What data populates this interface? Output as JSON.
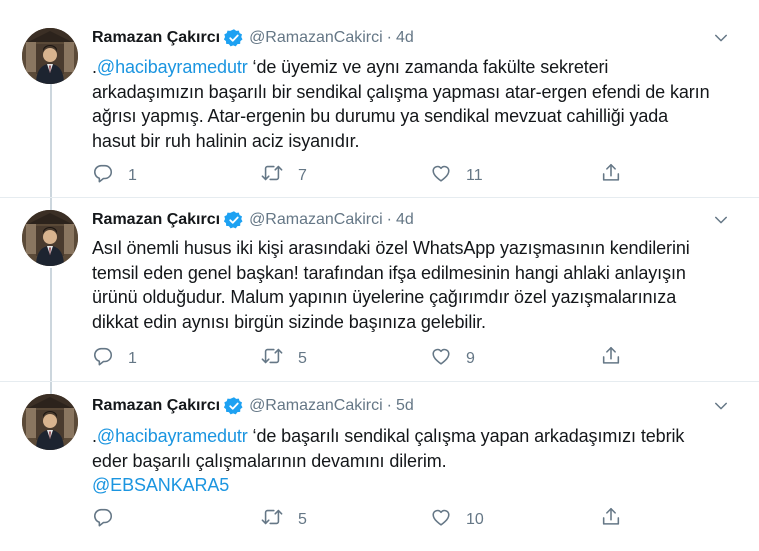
{
  "tweets": [
    {
      "author_name": "Ramazan Çakırcı",
      "handle": "@RamazanCakirci",
      "separator": "·",
      "time": "4d",
      "lines": [
        [
          {
            "t": "."
          },
          {
            "t": "@hacibayramedutr",
            "link": true
          },
          {
            "t": " ‘de  üyemiz ve aynı zamanda fakülte sekreteri"
          }
        ],
        [
          {
            "t": "arkadaşımızın başarılı bir sendikal çalışma yapması atar-ergen efendi de karın"
          }
        ],
        [
          {
            "t": "ağrısı yapmış. Atar-ergenin bu durumu ya sendikal mevzuat  cahilliği yada"
          }
        ],
        [
          {
            "t": "hasut bir ruh halinin aciz isyanıdır."
          }
        ]
      ],
      "reply_count": "1",
      "retweet_count": "7",
      "like_count": "11"
    },
    {
      "author_name": "Ramazan Çakırcı",
      "handle": "@RamazanCakirci",
      "separator": "·",
      "time": "4d",
      "lines": [
        [
          {
            "t": "Asıl önemli husus iki kişi arasındaki özel WhatsApp yazışmasının kendilerini"
          }
        ],
        [
          {
            "t": "temsil eden genel başkan! tarafından ifşa edilmesinin hangi ahlaki anlayışın"
          }
        ],
        [
          {
            "t": "ürünü olduğudur. Malum yapının üyelerine çağırımdır özel yazışmalarınıza"
          }
        ],
        [
          {
            "t": "dikkat edin aynısı birgün sizinde başınıza gelebilir."
          }
        ]
      ],
      "reply_count": "1",
      "retweet_count": "5",
      "like_count": "9"
    },
    {
      "author_name": "Ramazan Çakırcı",
      "handle": "@RamazanCakirci",
      "separator": "·",
      "time": "5d",
      "lines": [
        [
          {
            "t": "."
          },
          {
            "t": "@hacibayramedutr",
            "link": true
          },
          {
            "t": " ‘de başarılı sendikal çalışma yapan arkadaşımızı tebrik"
          }
        ],
        [
          {
            "t": "eder başarılı çalışmalarının devamını dilerim."
          }
        ],
        [
          {
            "t": "@EBSANKARA5",
            "link": true
          }
        ]
      ],
      "reply_count": "",
      "retweet_count": "5",
      "like_count": "10"
    }
  ],
  "icons": {
    "reply": "reply-icon",
    "retweet": "retweet-icon",
    "like": "like-icon",
    "share": "share-icon",
    "verified": "verified-badge-icon",
    "caret": "chevron-down-icon"
  },
  "colors": {
    "link": "#1b95e0",
    "muted": "#657786",
    "verified": "#1da1f2",
    "divider": "#e6ecf0"
  }
}
